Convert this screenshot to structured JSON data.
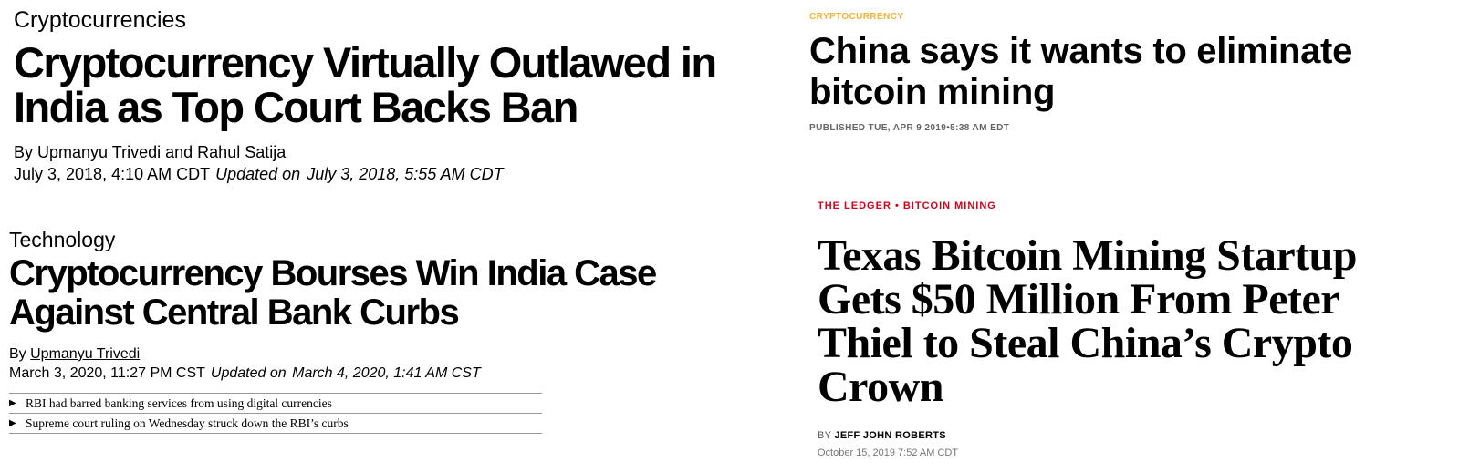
{
  "article_bloomberg_2018": {
    "section": "Cryptocurrencies",
    "headline": "Cryptocurrency Virtually Outlawed in India as Top Court Backs Ban",
    "by_prefix": "By",
    "authors": [
      "Upmanyu Trivedi",
      "Rahul Satija"
    ],
    "author_joiner": "and",
    "published": "July 3, 2018, 4:10 AM CDT",
    "updated_label": "Updated on",
    "updated": "July 3, 2018, 5:55 AM CDT"
  },
  "article_bloomberg_2020": {
    "section": "Technology",
    "headline": "Cryptocurrency Bourses Win India Case Against Central Bank Curbs",
    "by_prefix": "By",
    "author": "Upmanyu Trivedi",
    "published": "March 3, 2020, 11:27 PM CST",
    "updated_label": "Updated on",
    "updated": "March 4, 2020, 1:41 AM CST",
    "bullets": [
      "RBI had barred banking services from using digital currencies",
      "Supreme court ruling on Wednesday struck down the RBI’s curbs"
    ]
  },
  "article_cnbc": {
    "kicker": "CRYPTOCURRENCY",
    "headline": "China says it wants to eliminate bitcoin mining",
    "published": "PUBLISHED TUE, APR 9 2019•5:38 AM EDT",
    "kicker_color": "#f5b335"
  },
  "article_fortune": {
    "kicker": "THE LEDGER • BITCOIN MINING",
    "headline": "Texas Bitcoin Mining Startup Gets $50 Million From Peter Thiel to Steal China’s Crypto Crown",
    "by_prefix": "BY",
    "author": "JEFF JOHN ROBERTS",
    "date": "October 15, 2019 7:52 AM CDT",
    "kicker_color": "#d0021b"
  }
}
